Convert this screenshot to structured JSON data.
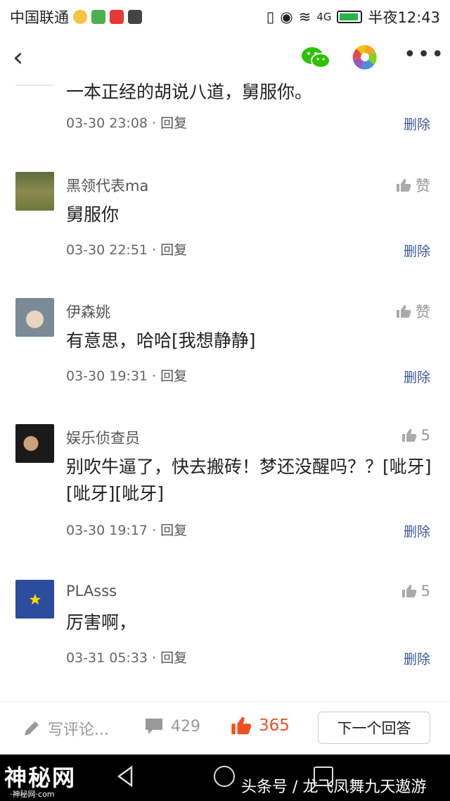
{
  "status_bar": {
    "carrier": "中国联通",
    "time": "半夜12:43",
    "network": "4G"
  },
  "title_bar": {
    "back_icon": "chevron-left-icon",
    "share_wechat_icon": "wechat-icon",
    "share_moments_icon": "moments-icon",
    "more_icon": "more-dots-icon"
  },
  "comments": [
    {
      "text": "一本正经的胡说八道，舅服你。",
      "date": "03-30 23:08",
      "reply": "回复",
      "delete": "删除"
    },
    {
      "name": "黑领代表ma",
      "like": "赞",
      "text": "舅服你",
      "date": "03-30 22:51",
      "reply": "回复",
      "delete": "删除"
    },
    {
      "name": "伊森姚",
      "like": "赞",
      "text": "有意思，哈哈[我想静静]",
      "date": "03-30 19:31",
      "reply": "回复",
      "delete": "删除"
    },
    {
      "name": "娱乐侦查员",
      "like": "5",
      "text": "别吹牛逼了，快去搬砖！梦还没醒吗？？[呲牙][呲牙][呲牙]",
      "date": "03-30 19:17",
      "reply": "回复",
      "delete": "删除"
    },
    {
      "name": "PLAsss",
      "like": "5",
      "text": "厉害啊，",
      "date": "03-31 05:33",
      "reply": "回复",
      "delete": "删除"
    }
  ],
  "bottom_bar": {
    "compose_placeholder": "写评论...",
    "comment_count": "429",
    "like_count": "365",
    "next_answer": "下一个回答"
  },
  "watermark": {
    "left": "神秘网",
    "left_sub": "·神秘网·com",
    "right": "头条号 / 龙飞凤舞九天遨游"
  },
  "colors": {
    "like_accent": "#f04e23",
    "delete_link": "#3b5998",
    "wechat_green": "#2dc100"
  }
}
